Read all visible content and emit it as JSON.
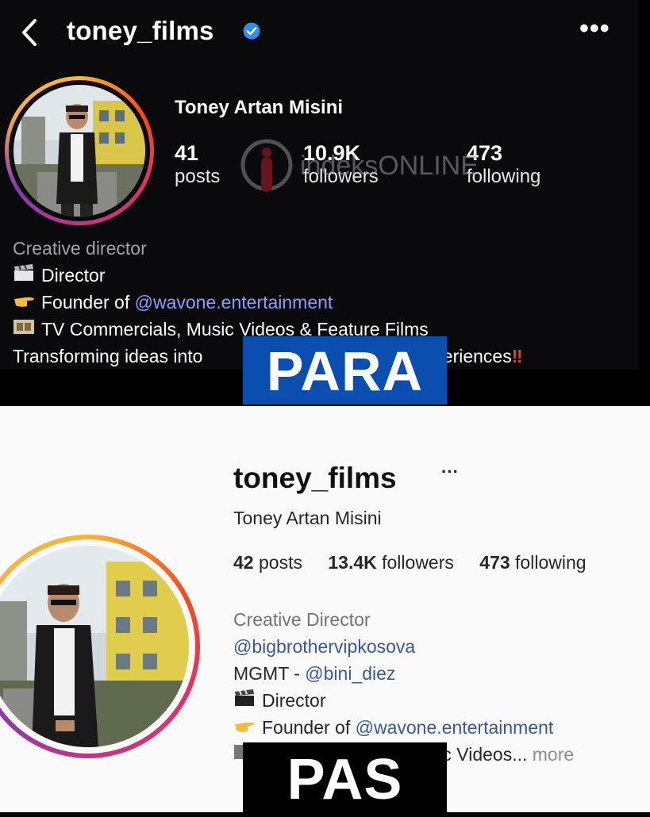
{
  "top": {
    "username": "toney_films",
    "full_name": "Toney Artan Misini",
    "more_label": "•••",
    "stats": [
      {
        "num": "41",
        "label": "posts"
      },
      {
        "num": "10.9K",
        "label": "followers"
      },
      {
        "num": "473",
        "label": "following"
      }
    ],
    "bio": {
      "category": "Creative director",
      "line1": "Director",
      "line2_prefix": "Founder of ",
      "line2_mention": "@wavone.entertainment",
      "line3": "TV Commercials, Music Videos & Feature Films",
      "line4": "Transforming ideas into",
      "line4_end": "xperiences",
      "line4_bangs": "‼"
    },
    "watermark": "indeksONLINE",
    "label": "PARA",
    "label_color": "#0a4fb0"
  },
  "bottom": {
    "username": "toney_films",
    "more_label": "···",
    "full_name": "Toney Artan Misini",
    "stats": [
      {
        "num": "42",
        "label": "posts"
      },
      {
        "num": "13.4K",
        "label": "followers"
      },
      {
        "num": "473",
        "label": "following"
      }
    ],
    "bio": {
      "category": "Creative Director",
      "mention1": "@bigbrothervipkosova",
      "mgmt_prefix": "MGMT - ",
      "mgmt_mention": "@bini_diez",
      "line_director": "Director",
      "founder_prefix": "Founder of ",
      "founder_mention": "@wavone.entertainment",
      "line_videos": "usic Videos...",
      "more": "more"
    },
    "label": "PAS",
    "label_color": "#000000"
  },
  "icons": {
    "back": "chevron-left-icon",
    "verified": "verified-badge-icon",
    "more": "more-horizontal-icon",
    "clapper": "clapperboard-icon",
    "pointing": "pointing-hand-icon",
    "film": "film-frames-icon"
  }
}
